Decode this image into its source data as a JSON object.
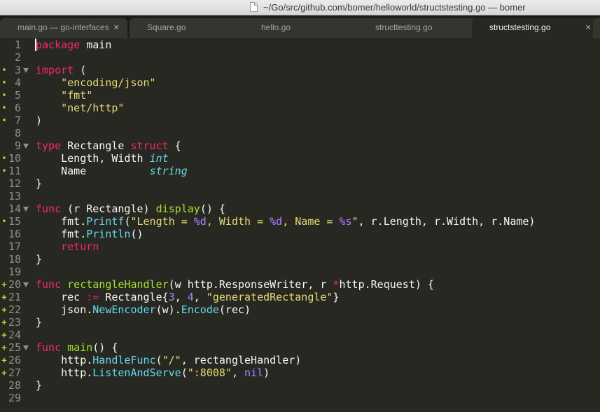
{
  "window": {
    "title": "~/Go/src/github.com/bomer/helloworld/structstesting.go — bomer"
  },
  "tabs": [
    {
      "label": "main.go — go-interfaces",
      "close": "×",
      "active": false
    },
    {
      "label": "Square.go",
      "close": "×",
      "active": false
    },
    {
      "label": "hello.go",
      "close": "×",
      "active": false
    },
    {
      "label": "structtesting.go",
      "close": "×",
      "active": false
    },
    {
      "label": "structstesting.go",
      "close": "×",
      "active": true
    }
  ],
  "colors": {
    "background": "#272822",
    "keyword": "#f92672",
    "string": "#e6db74",
    "type": "#66d9ef",
    "function": "#a6e22e",
    "number": "#ae81ff",
    "modified_marker": "#d7c737",
    "added_marker": "#a6e22e"
  },
  "editor": {
    "lines": [
      {
        "n": "1",
        "marker": "",
        "fold": false,
        "tokens": [
          [
            "kw",
            "package"
          ],
          [
            "",
            " main"
          ]
        ]
      },
      {
        "n": "2",
        "marker": "",
        "fold": false,
        "tokens": []
      },
      {
        "n": "3",
        "marker": "•",
        "fold": true,
        "tokens": [
          [
            "kw",
            "import"
          ],
          [
            "",
            " ("
          ]
        ]
      },
      {
        "n": "4",
        "marker": "•",
        "fold": false,
        "tokens": [
          [
            "",
            "    "
          ],
          [
            "str",
            "\"encoding/json\""
          ]
        ]
      },
      {
        "n": "5",
        "marker": "•",
        "fold": false,
        "tokens": [
          [
            "",
            "    "
          ],
          [
            "str",
            "\"fmt\""
          ]
        ]
      },
      {
        "n": "6",
        "marker": "•",
        "fold": false,
        "tokens": [
          [
            "",
            "    "
          ],
          [
            "str",
            "\"net/http\""
          ]
        ]
      },
      {
        "n": "7",
        "marker": "•",
        "fold": false,
        "tokens": [
          [
            "",
            ")"
          ]
        ]
      },
      {
        "n": "8",
        "marker": "",
        "fold": false,
        "tokens": []
      },
      {
        "n": "9",
        "marker": "",
        "fold": true,
        "tokens": [
          [
            "kw",
            "type"
          ],
          [
            "",
            " Rectangle "
          ],
          [
            "kw",
            "struct"
          ],
          [
            "",
            " {"
          ]
        ]
      },
      {
        "n": "10",
        "marker": "•",
        "fold": false,
        "tokens": [
          [
            "",
            "    Length, Width "
          ],
          [
            "typ",
            "int"
          ]
        ]
      },
      {
        "n": "11",
        "marker": "•",
        "fold": false,
        "tokens": [
          [
            "",
            "    Name          "
          ],
          [
            "typ",
            "string"
          ]
        ]
      },
      {
        "n": "12",
        "marker": "",
        "fold": false,
        "tokens": [
          [
            "",
            "}"
          ]
        ]
      },
      {
        "n": "13",
        "marker": "",
        "fold": false,
        "tokens": []
      },
      {
        "n": "14",
        "marker": "",
        "fold": true,
        "tokens": [
          [
            "kw",
            "func"
          ],
          [
            "",
            " (r Rectangle) "
          ],
          [
            "fn",
            "display"
          ],
          [
            "",
            "() {"
          ]
        ]
      },
      {
        "n": "15",
        "marker": "•",
        "fold": false,
        "tokens": [
          [
            "",
            "    fmt."
          ],
          [
            "call",
            "Printf"
          ],
          [
            "",
            "("
          ],
          [
            "str",
            "\"Length = "
          ],
          [
            "num",
            "%d"
          ],
          [
            "str",
            ", Width = "
          ],
          [
            "num",
            "%d"
          ],
          [
            "str",
            ", Name = "
          ],
          [
            "num",
            "%s"
          ],
          [
            "str",
            "\""
          ],
          [
            "",
            ", r.Length, r.Width, r.Name)"
          ]
        ]
      },
      {
        "n": "16",
        "marker": "",
        "fold": false,
        "tokens": [
          [
            "",
            "    fmt."
          ],
          [
            "call",
            "Println"
          ],
          [
            "",
            "()"
          ]
        ]
      },
      {
        "n": "17",
        "marker": "",
        "fold": false,
        "tokens": [
          [
            "",
            "    "
          ],
          [
            "kw",
            "return"
          ]
        ]
      },
      {
        "n": "18",
        "marker": "",
        "fold": false,
        "tokens": [
          [
            "",
            "}"
          ]
        ]
      },
      {
        "n": "19",
        "marker": "",
        "fold": false,
        "tokens": []
      },
      {
        "n": "20",
        "marker": "+",
        "fold": true,
        "tokens": [
          [
            "kw",
            "func"
          ],
          [
            "",
            " "
          ],
          [
            "fn",
            "rectangleHandler"
          ],
          [
            "",
            "(w http.ResponseWriter, r "
          ],
          [
            "op",
            "*"
          ],
          [
            "",
            "http.Request) {"
          ]
        ]
      },
      {
        "n": "21",
        "marker": "+",
        "fold": false,
        "tokens": [
          [
            "",
            "    rec "
          ],
          [
            "op",
            ":="
          ],
          [
            "",
            " Rectangle{"
          ],
          [
            "num",
            "3"
          ],
          [
            "",
            ", "
          ],
          [
            "num",
            "4"
          ],
          [
            "",
            ", "
          ],
          [
            "str",
            "\"generatedRectangle\""
          ],
          [
            "",
            "}"
          ]
        ]
      },
      {
        "n": "22",
        "marker": "+",
        "fold": false,
        "tokens": [
          [
            "",
            "    json."
          ],
          [
            "call",
            "NewEncoder"
          ],
          [
            "",
            "(w)."
          ],
          [
            "call",
            "Encode"
          ],
          [
            "",
            "(rec)"
          ]
        ]
      },
      {
        "n": "23",
        "marker": "+",
        "fold": false,
        "tokens": [
          [
            "",
            "}"
          ]
        ]
      },
      {
        "n": "24",
        "marker": "+",
        "fold": false,
        "tokens": []
      },
      {
        "n": "25",
        "marker": "+",
        "fold": true,
        "tokens": [
          [
            "kw",
            "func"
          ],
          [
            "",
            " "
          ],
          [
            "fn",
            "main"
          ],
          [
            "",
            "() {"
          ]
        ]
      },
      {
        "n": "26",
        "marker": "+",
        "fold": false,
        "tokens": [
          [
            "",
            "    http."
          ],
          [
            "call",
            "HandleFunc"
          ],
          [
            "",
            "("
          ],
          [
            "str",
            "\"/\""
          ],
          [
            "",
            ", rectangleHandler)"
          ]
        ]
      },
      {
        "n": "27",
        "marker": "+",
        "fold": false,
        "tokens": [
          [
            "",
            "    http."
          ],
          [
            "call",
            "ListenAndServe"
          ],
          [
            "",
            "("
          ],
          [
            "str",
            "\":8008\""
          ],
          [
            "",
            ", "
          ],
          [
            "num",
            "nil"
          ],
          [
            "",
            ")"
          ]
        ]
      },
      {
        "n": "28",
        "marker": "",
        "fold": false,
        "tokens": [
          [
            "",
            "}"
          ]
        ]
      },
      {
        "n": "29",
        "marker": "",
        "fold": false,
        "tokens": []
      }
    ]
  }
}
